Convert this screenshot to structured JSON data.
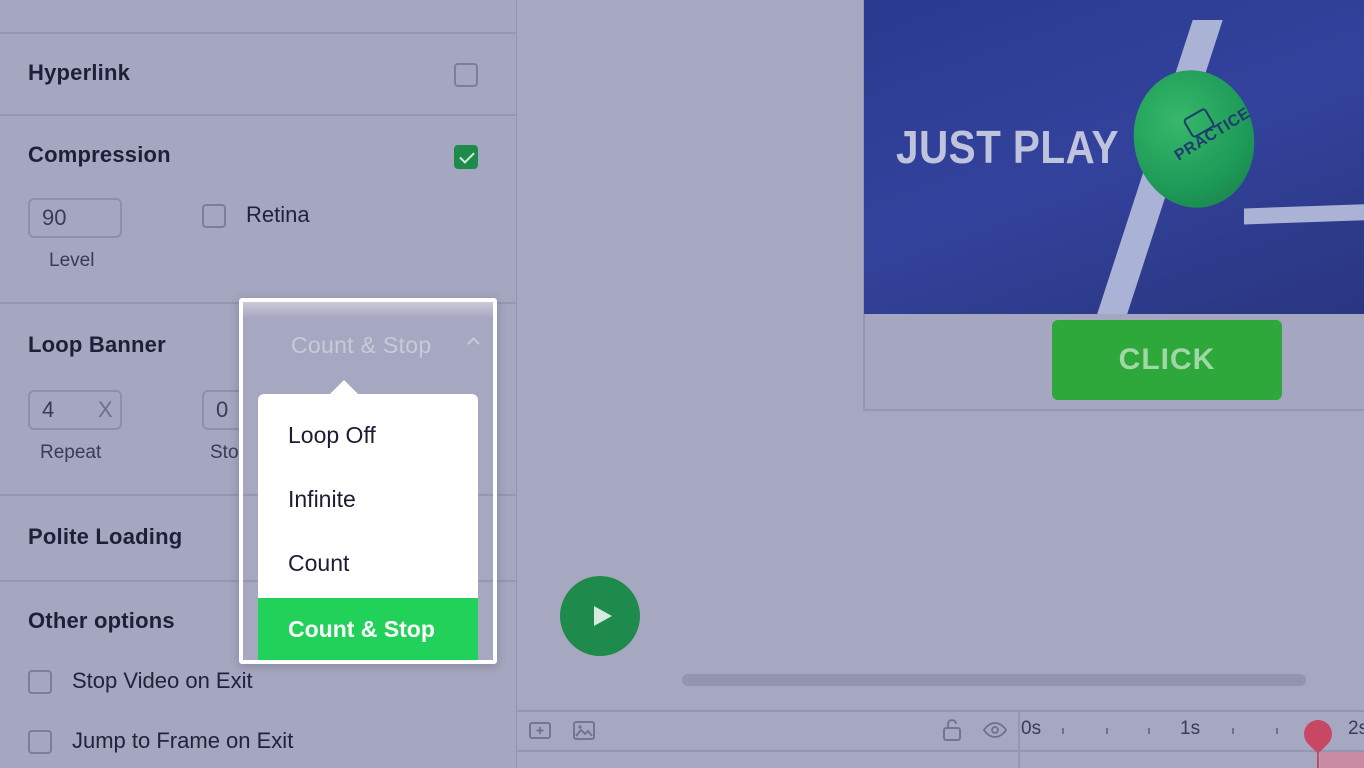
{
  "left_panel": {
    "hyperlink": {
      "title": "Hyperlink",
      "checked": false
    },
    "compression": {
      "title": "Compression",
      "checked": true,
      "level_value": "90",
      "level_label": "Level",
      "retina_label": "Retina",
      "retina_checked": false
    },
    "loop_banner": {
      "title": "Loop Banner",
      "repeat_value": "4",
      "repeat_suffix": "X",
      "repeat_label": "Repeat",
      "stop_value": "0",
      "stop_label_partial": "Stop"
    },
    "polite_loading": {
      "title": "Polite Loading"
    },
    "other_options": {
      "title": "Other options",
      "items": [
        {
          "label": "Stop Video on Exit",
          "checked": false
        },
        {
          "label": "Jump to Frame on Exit",
          "checked": false
        }
      ]
    }
  },
  "loop_dropdown": {
    "selected": "Count & Stop",
    "options": [
      "Loop Off",
      "Infinite",
      "Count",
      "Count & Stop"
    ],
    "active_index": 3
  },
  "preview": {
    "headline": "JUST PLAY",
    "ball_text": "PRACTICE",
    "cta_label": "CLICK"
  },
  "timeline": {
    "ticks": [
      "0s",
      "1s",
      "2s"
    ]
  },
  "colors": {
    "accent_green": "#22d15a",
    "cta_green": "#2ea83a",
    "playhead": "#c84864"
  }
}
